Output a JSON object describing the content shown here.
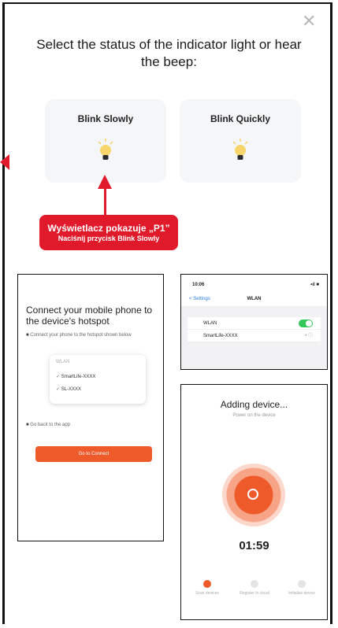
{
  "title": "Select the status of the indicator light or hear the beep:",
  "options": [
    {
      "label": "Blink Slowly"
    },
    {
      "label": "Blink Quickly"
    }
  ],
  "callout": {
    "main": "Wyświetlacz pokazuje „P1”",
    "sub": "Naciśnij przycisk Blink Slowly"
  },
  "connect_screen": {
    "heading": "Connect your mobile phone to the device's hotspot",
    "step1": "Connect your phone to the hotspot shown below",
    "wifi_header": "WLAN",
    "networks": [
      "SmartLife-XXXX",
      "SL-XXXX"
    ],
    "step2": "Go back to the app",
    "button": "Go to Connect"
  },
  "wifi_settings": {
    "time": "10:06",
    "signal": "•ıl ■",
    "back": "< Settings",
    "header": "WLAN",
    "row_wlan": "WLAN",
    "row_network": "SmartLife-XXXX",
    "network_info": "• ⓘ"
  },
  "adding_screen": {
    "title": "Adding device...",
    "subtitle": "Power on the device",
    "timer": "01:59",
    "steps": [
      "Scan devices",
      "Register to cloud",
      "Initialize device"
    ]
  },
  "colors": {
    "accent": "#e0192b",
    "orange": "#ee5a2a",
    "card_bg": "#f5f6f8",
    "bulb": "#f6d66a"
  }
}
